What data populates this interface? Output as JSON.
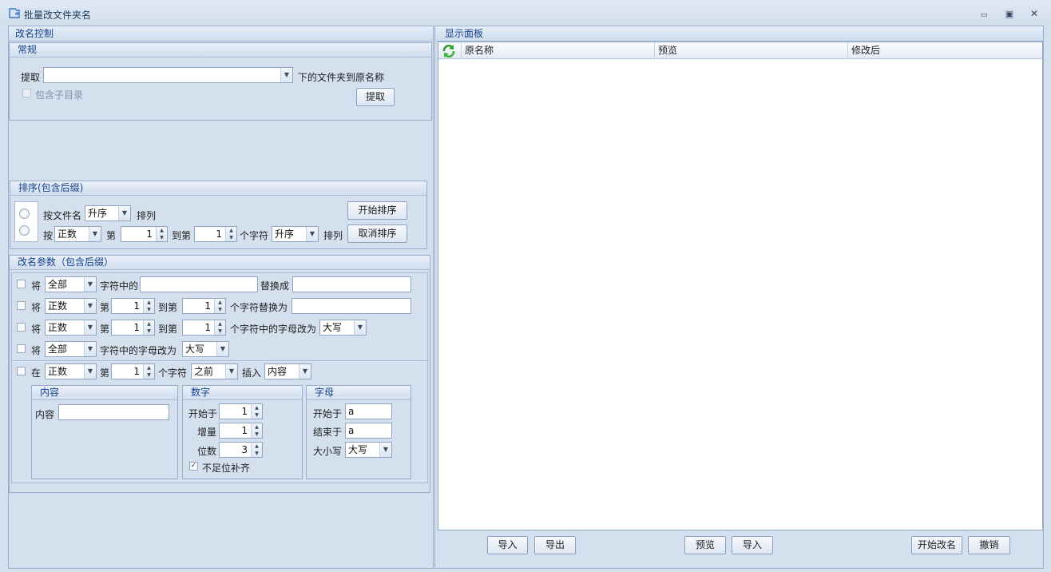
{
  "window": {
    "title": "批量改文件夹名",
    "minimize_glyph": "▭",
    "maximize_glyph": "▣",
    "close_glyph": "✕"
  },
  "left": {
    "title": "改名控制",
    "general": {
      "title": "常规",
      "extract_label": "提取",
      "path_value": "",
      "suffix_label": "下的文件夹到原名称",
      "include_subdirs_label": "包含子目录",
      "extract_button": "提取"
    },
    "sort": {
      "title": "排序(包含后缀)",
      "by_name_label": "按文件名",
      "order1": "升序",
      "arrange1": "排列",
      "by_label": "按",
      "direction": "正数",
      "nth_label": "第",
      "from": "1",
      "to_label": "到第",
      "to": "1",
      "char_label": "个字符",
      "order2": "升序",
      "arrange2": "排列",
      "start_button": "开始排序",
      "cancel_button": "取消排序"
    },
    "rename": {
      "title": "改名参数（包含后缀）",
      "jiang": "将",
      "zai": "在",
      "nth": "第",
      "to_nth": "到第",
      "row1": {
        "scope": "全部",
        "mid_label": "字符中的",
        "find": "",
        "replace_label": "替换成",
        "replace": ""
      },
      "row2": {
        "direction": "正数",
        "from": "1",
        "to": "1",
        "label": "个字符替换为",
        "value": ""
      },
      "row3": {
        "direction": "正数",
        "from": "1",
        "to": "1",
        "label": "个字符中的字母改为",
        "case": "大写"
      },
      "row4": {
        "scope": "全部",
        "label": "字符中的字母改为",
        "case": "大写"
      },
      "row5": {
        "direction": "正数",
        "from": "1",
        "char_label": "个字符",
        "position": "之前",
        "insert_label": "插入",
        "insert_type": "内容"
      },
      "content": {
        "title": "内容",
        "label": "内容",
        "value": ""
      },
      "number": {
        "title": "数字",
        "start_label": "开始于",
        "start": "1",
        "step_label": "增量",
        "step": "1",
        "digits_label": "位数",
        "digits": "3",
        "pad_label": "不足位补齐"
      },
      "letter": {
        "title": "字母",
        "start_label": "开始于",
        "start": "a",
        "end_label": "结束于",
        "end": "a",
        "case_label": "大小写",
        "case": "大写"
      }
    }
  },
  "right": {
    "title": "显示面板",
    "columns": [
      "原名称",
      "预览",
      "修改后"
    ],
    "buttons": {
      "import1": "导入",
      "export": "导出",
      "preview": "预览",
      "import2": "导入",
      "start_rename": "开始改名",
      "undo": "撤销"
    }
  },
  "colors": {
    "accent_text": "#15428b",
    "panel_bg": "#d5e0ef",
    "border": "#9bb0cc"
  },
  "icons": {
    "app": "folder-rename-icon",
    "refresh": "refresh-icon",
    "dropdown": "chevron-down-icon",
    "spinner": "spinner-arrows-icon"
  }
}
